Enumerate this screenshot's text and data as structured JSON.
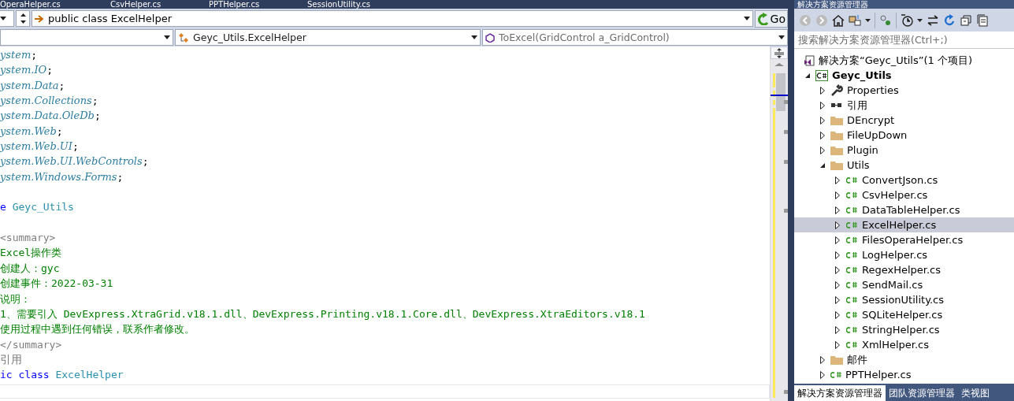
{
  "doc_tabs": [
    {
      "label": "OperaHelper.cs"
    },
    {
      "label": "CsvHelper.cs"
    },
    {
      "label": "PPTHelper.cs"
    },
    {
      "label": "SessionUtility.cs"
    }
  ],
  "nav_bar": {
    "member": "public class ExcelHelper",
    "go": "Go"
  },
  "dropdowns": [
    {
      "kind": "blank"
    },
    {
      "label": "Geyc_Utils.ExcelHelper",
      "kind": "class"
    },
    {
      "label": "ToExcel(GridControl a_GridControl)",
      "kind": "method"
    }
  ],
  "code_lines": [
    [
      {
        "text": "ystem",
        "kind": "ns"
      },
      {
        "text": ";",
        "kind": "plain"
      }
    ],
    [
      {
        "text": "ystem.IO",
        "kind": "ns"
      },
      {
        "text": ";",
        "kind": "plain"
      }
    ],
    [
      {
        "text": "ystem.Data",
        "kind": "ns"
      },
      {
        "text": ";",
        "kind": "plain"
      }
    ],
    [
      {
        "text": "ystem.Collections",
        "kind": "ns"
      },
      {
        "text": ";",
        "kind": "plain"
      }
    ],
    [
      {
        "text": "ystem.Data.OleDb",
        "kind": "ns"
      },
      {
        "text": ";",
        "kind": "plain"
      }
    ],
    [
      {
        "text": "ystem.Web",
        "kind": "ns"
      },
      {
        "text": ";",
        "kind": "plain"
      }
    ],
    [
      {
        "text": "ystem.Web.UI",
        "kind": "ns"
      },
      {
        "text": ";",
        "kind": "plain"
      }
    ],
    [
      {
        "text": "ystem.Web.UI.WebControls",
        "kind": "ns"
      },
      {
        "text": ";",
        "kind": "plain"
      }
    ],
    [
      {
        "text": "ystem.Windows.Forms",
        "kind": "ns"
      },
      {
        "text": ";",
        "kind": "plain"
      }
    ],
    [
      {
        "text": "e",
        "kind": "keyword",
        "gap_before": true
      },
      {
        "text": " Geyc_Utils",
        "kind": "type"
      }
    ],
    [
      {
        "text": "<summary>",
        "kind": "doctag",
        "gap_before": true
      }
    ],
    [
      {
        "text": "Excel操作类",
        "kind": "comment"
      }
    ],
    [
      {
        "text": "创建人：gyc",
        "kind": "comment"
      }
    ],
    [
      {
        "text": "创建事件：2022-03-31",
        "kind": "comment"
      }
    ],
    [
      {
        "text": "说明：",
        "kind": "comment"
      }
    ],
    [
      {
        "text": "1、需要引入 DevExpress.XtraGrid.v18.1.dll、DevExpress.Printing.v18.1.Core.dll、DevExpress.XtraEditors.v18.1",
        "kind": "comment"
      }
    ],
    [
      {
        "text": "使用过程中遇到任何错误，联系作者修改。",
        "kind": "comment"
      }
    ],
    [
      {
        "text": "</summary>",
        "kind": "doctag"
      }
    ],
    [
      {
        "text": "引用",
        "kind": "lens"
      }
    ],
    [
      {
        "text": "ic class",
        "kind": "keyword"
      },
      {
        "text": " ExcelHelper",
        "kind": "type"
      }
    ]
  ],
  "solution_explorer": {
    "title": "解决方案资源管理器",
    "search": {
      "placeholder": "搜索解决方案资源管理器(Ctrl+;)"
    },
    "tree": [
      {
        "label": "解决方案“Geyc_Utils”(1 个项目)",
        "kind": "solution",
        "selected": false,
        "children": [
          {
            "label": "Geyc_Utils",
            "kind": "project",
            "expanded": true,
            "selected": false,
            "children": [
              {
                "label": "Properties",
                "kind": "wrench",
                "expanded": false,
                "selected": false
              },
              {
                "label": "引用",
                "kind": "references",
                "expanded": false,
                "selected": false
              },
              {
                "label": "DEncrypt",
                "kind": "folder",
                "expanded": false,
                "selected": false
              },
              {
                "label": "FileUpDown",
                "kind": "folder",
                "expanded": false,
                "selected": false
              },
              {
                "label": "Plugin",
                "kind": "folder",
                "expanded": false,
                "selected": false
              },
              {
                "label": "Utils",
                "kind": "folder",
                "expanded": true,
                "selected": false,
                "children": [
                  {
                    "label": "ConvertJson.cs",
                    "kind": "file",
                    "expanded": false,
                    "selected": false
                  },
                  {
                    "label": "CsvHelper.cs",
                    "kind": "file",
                    "expanded": false,
                    "selected": false
                  },
                  {
                    "label": "DataTableHelper.cs",
                    "kind": "file",
                    "expanded": false,
                    "selected": false
                  },
                  {
                    "label": "ExcelHelper.cs",
                    "kind": "file",
                    "expanded": false,
                    "selected": true
                  },
                  {
                    "label": "FilesOperaHelper.cs",
                    "kind": "file",
                    "expanded": false,
                    "selected": false
                  },
                  {
                    "label": "LogHelper.cs",
                    "kind": "file",
                    "expanded": false,
                    "selected": false
                  },
                  {
                    "label": "RegexHelper.cs",
                    "kind": "file",
                    "expanded": false,
                    "selected": false
                  },
                  {
                    "label": "SendMail.cs",
                    "kind": "file",
                    "expanded": false,
                    "selected": false
                  },
                  {
                    "label": "SessionUtility.cs",
                    "kind": "file",
                    "expanded": false,
                    "selected": false
                  },
                  {
                    "label": "SQLiteHelper.cs",
                    "kind": "file",
                    "expanded": false,
                    "selected": false
                  },
                  {
                    "label": "StringHelper.cs",
                    "kind": "file",
                    "expanded": false,
                    "selected": false
                  },
                  {
                    "label": "XmlHelper.cs",
                    "kind": "file",
                    "expanded": false,
                    "selected": false
                  }
                ]
              },
              {
                "label": "邮件",
                "kind": "folder",
                "expanded": false,
                "selected": false
              },
              {
                "label": "PPTHelper.cs",
                "kind": "file",
                "expanded": false,
                "selected": false
              }
            ]
          }
        ]
      }
    ],
    "bottom_tabs": [
      {
        "label": "解决方案资源管理器",
        "selected": true
      },
      {
        "label": "团队资源管理器",
        "selected": false
      },
      {
        "label": "类视图",
        "selected": false
      }
    ]
  }
}
